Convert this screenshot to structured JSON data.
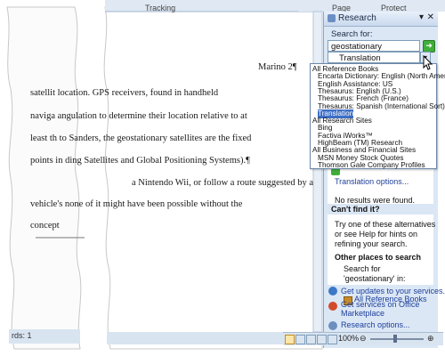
{
  "ruler": {
    "tabs": [
      "Tracking",
      "Page",
      "Protect"
    ]
  },
  "document": {
    "header": "Marino 2¶",
    "lines": [
      "satellit   location. GPS receivers, found in handheld",
      "naviga   angulation to determine their location relative to at",
      "least th   to Sanders, the geostationary satellites are the fixed",
      "points in   ding Satellites and Global Positioning Systems).¶",
      "a Nintendo Wii, or follow a route suggested by a",
      "vehicle's   none of it might have been possible without the",
      "concept"
    ]
  },
  "status": {
    "words": "rds: 1",
    "zoom": "100%"
  },
  "research": {
    "title": "Research",
    "search_label": "Search for:",
    "search_value": "geostationary",
    "source_value": "Translation",
    "dropdown": [
      "All Reference Books",
      "Encarta Dictionary: English (North America)",
      "English Assistance: US",
      "Thesaurus: English (U.S.)",
      "Thesaurus: French (France)",
      "Thesaurus: Spanish (International Sort)",
      "Translation",
      "All Research Sites",
      "Bing",
      "Factiva iWorks™",
      "HighBeam (TM) Research",
      "All Business and Financial Sites",
      "MSN Money Stock Quotes",
      "Thomson Gale Company Profiles"
    ],
    "selected_index": 6,
    "translation_options": "Translation options...",
    "no_results": "No results were found.",
    "cant_find": "Can't find it?",
    "alt_lines": [
      "Try one of these alternatives",
      "or see Help for hints on",
      "refining your search."
    ],
    "other_places": "Other places to search",
    "search_for_lines": [
      "Search for",
      "'geostationary' in:"
    ],
    "all_ref": "All Reference Books",
    "bottom_links": [
      "Get updates to your services...",
      "Get services on Office",
      "Marketplace",
      "Research options..."
    ]
  }
}
